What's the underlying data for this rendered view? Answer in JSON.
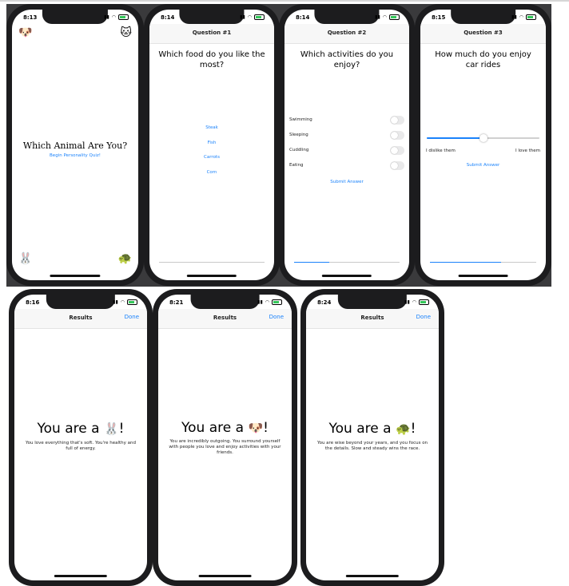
{
  "screens": {
    "welcome": {
      "time": "8:13",
      "emoji_dog": "🐶",
      "emoji_cat": "🐱",
      "emoji_rabbit": "🐰",
      "emoji_turtle": "🐢",
      "title": "Which Animal Are You?",
      "begin_button": "Begin Personality Quiz!"
    },
    "question1": {
      "time": "8:14",
      "nav_title": "Question #1",
      "question": "Which food do you like the most?",
      "answers": [
        "Steak",
        "Fish",
        "Carrots",
        "Corn"
      ],
      "progress": 0.0
    },
    "question2": {
      "time": "8:14",
      "nav_title": "Question #2",
      "question": "Which activities do you enjoy?",
      "options": [
        "Swimming",
        "Sleeping",
        "Cuddling",
        "Eating"
      ],
      "submit_label": "Submit Answer",
      "progress": 0.33
    },
    "question3": {
      "time": "8:15",
      "nav_title": "Question #3",
      "question": "How much do you enjoy car rides",
      "min_label": "I dislike them",
      "max_label": "I love them",
      "slider_value": 0.5,
      "submit_label": "Submit Answer",
      "progress": 0.67
    },
    "result_rabbit": {
      "time": "8:16",
      "nav_title": "Results",
      "done_label": "Done",
      "heading_prefix": "You are a",
      "emoji": "🐰",
      "heading_suffix": "!",
      "description": "You love everything that's soft. You're healthy and full of energy."
    },
    "result_dog": {
      "time": "8:21",
      "nav_title": "Results",
      "done_label": "Done",
      "heading_prefix": "You are a",
      "emoji": "🐶",
      "heading_suffix": "!",
      "description": "You are incredibly outgoing. You surround yourself with people you love and enjoy activities with your friends."
    },
    "result_turtle": {
      "time": "8:24",
      "nav_title": "Results",
      "done_label": "Done",
      "heading_prefix": "You are a",
      "emoji": "🐢",
      "heading_suffix": "!",
      "description": "You are wise beyond your years, and you focus on the details. Slow and steady wins the race."
    }
  },
  "icons": {
    "signal": "signal-icon",
    "wifi": "wifi-icon",
    "battery": "battery-icon"
  },
  "colors": {
    "accent": "#1a82fb",
    "phone_frame": "#1c1c1e",
    "row_background": "#3a3a3c"
  }
}
